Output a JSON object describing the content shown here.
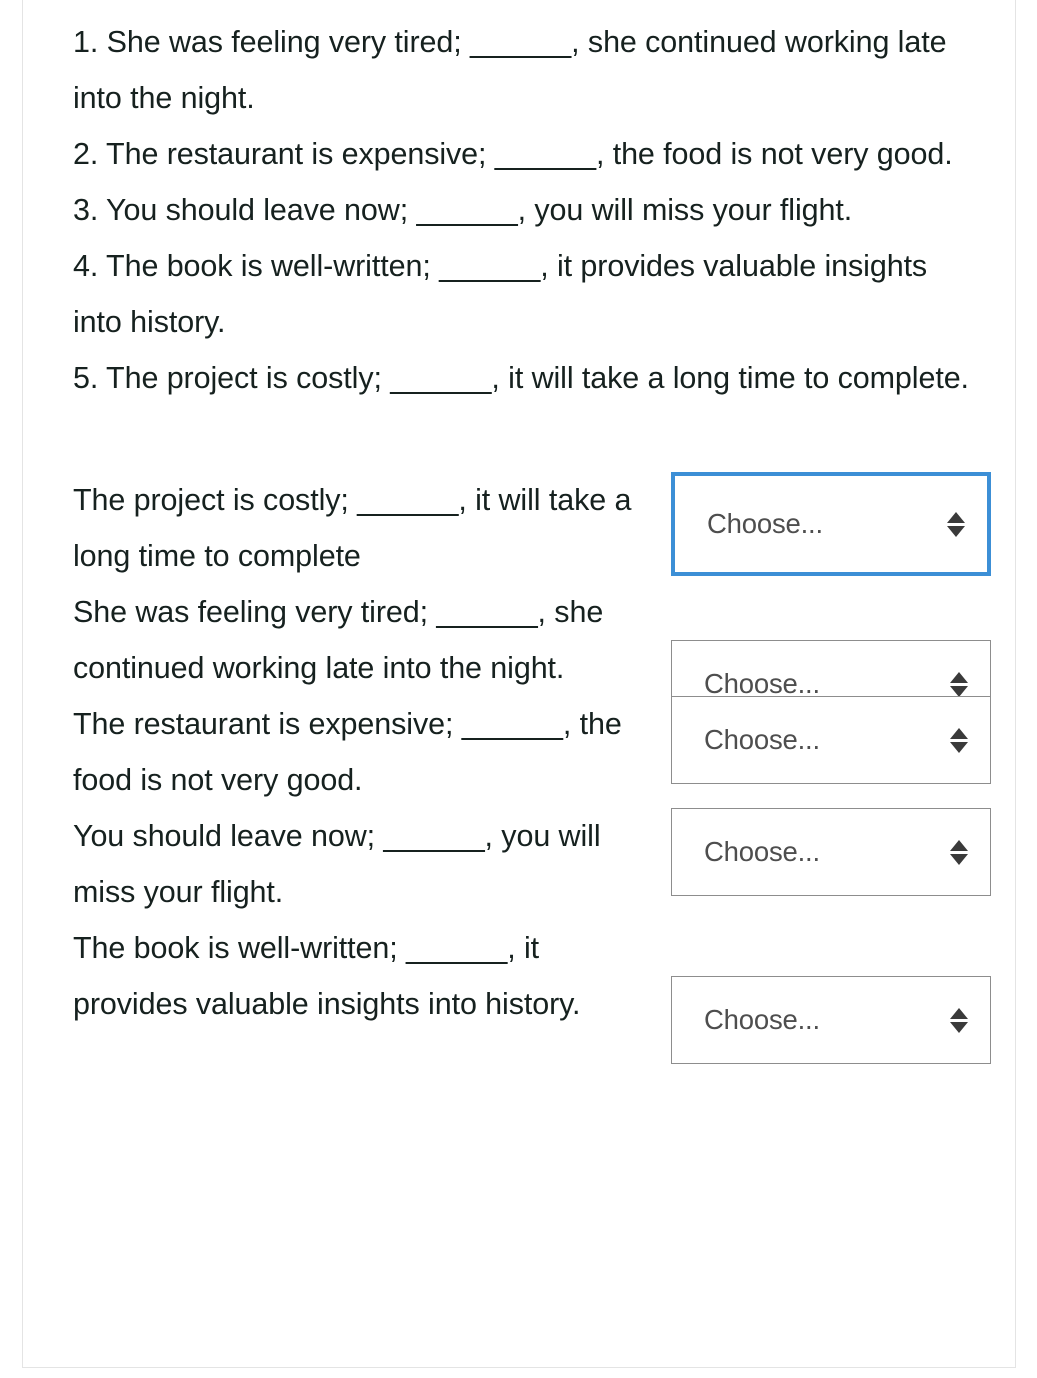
{
  "exercise": {
    "instruction_items": [
      "1. She was feeling very tired; ______, she continued working late into the night.",
      "2. The restaurant is expensive; ______, the food is not very good.",
      "3. You should leave now; ______, you will miss your flight.",
      "4. The book is well-written; ______, it provides valuable insights into history.",
      "5. The project is costly; ______, it will take a long time to complete."
    ],
    "matching_rows": [
      {
        "sentence": "The project is costly; ______, it will take a long time to complete",
        "dropdown": {
          "value": "Choose...",
          "focused": true,
          "icon": "updown-arrow-icon"
        }
      },
      {
        "sentence": "She was feeling very tired; ______, she continued working late into the night.",
        "dropdown": {
          "value": "Choose...",
          "focused": false,
          "icon": "updown-arrow-icon"
        }
      },
      {
        "sentence": "The restaurant is expensive; ______, the food is not very good.",
        "dropdown": {
          "value": "Choose...",
          "focused": false,
          "icon": "updown-arrow-icon"
        }
      },
      {
        "sentence": "You should leave now; ______, you will miss your flight.",
        "dropdown": {
          "value": "Choose...",
          "focused": false,
          "icon": "updown-arrow-icon"
        }
      },
      {
        "sentence": "The book is well-written; ______, it provides valuable insights into history.",
        "dropdown": {
          "value": "Choose...",
          "focused": false,
          "icon": "updown-arrow-icon"
        }
      }
    ]
  },
  "colors": {
    "text": "#16211f",
    "select_text": "#4e4e4e",
    "select_border": "#8d8d8d",
    "focus_border": "#3c8fd6",
    "page_border": "#e4e4e4",
    "arrow": "#3a3a3a",
    "background": "#ffffff"
  }
}
